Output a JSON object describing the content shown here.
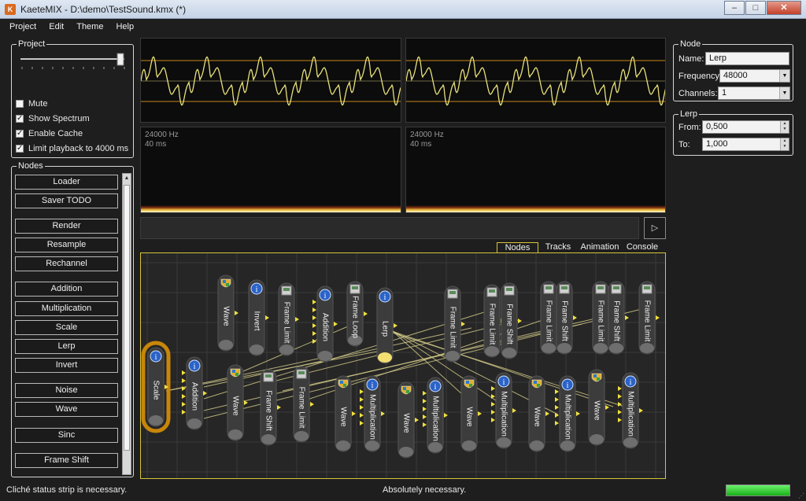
{
  "window": {
    "title": "KaeteMIX - D:\\demo\\TestSound.kmx (*)",
    "app_icon_text": "K",
    "controls": [
      "–",
      "□",
      "✕"
    ]
  },
  "menubar": [
    "Project",
    "Edit",
    "Theme",
    "Help"
  ],
  "project": {
    "label": "Project",
    "volume": 0.95,
    "checkboxes": [
      {
        "label": "Mute",
        "checked": false
      },
      {
        "label": "Show Spectrum",
        "checked": true
      },
      {
        "label": "Enable Cache",
        "checked": true
      },
      {
        "label": "Limit playback to 4000 ms",
        "checked": true
      }
    ]
  },
  "nodes_panel": {
    "label": "Nodes",
    "buttons": [
      "Loader",
      "Saver TODO",
      "Render",
      "Resample",
      "Rechannel",
      "Addition",
      "Multiplication",
      "Scale",
      "Lerp",
      "Invert",
      "Noise",
      "Wave",
      "Sinc",
      "Frame Shift"
    ]
  },
  "spectrum": {
    "left": {
      "freq": "24000 Hz",
      "time": "40 ms"
    },
    "right": {
      "freq": "24000 Hz",
      "time": "40 ms"
    }
  },
  "play_icon": "play-icon",
  "tabs": [
    {
      "label": "Nodes",
      "active": true
    },
    {
      "label": "Tracks",
      "active": false
    },
    {
      "label": "Animation",
      "active": false
    },
    {
      "label": "Console",
      "active": false
    }
  ],
  "graph_nodes": [
    "Scale",
    "Addition",
    "Wave",
    "Invert",
    "Frame Limit",
    "Addition",
    "Frame Loop",
    "Lerp",
    "Frame Limit",
    "Frame Limit",
    "Frame Shift",
    "Frame Limit",
    "Frame Shift",
    "Frame Limit",
    "Frame Shift",
    "Frame Limit",
    "Wave",
    "Frame Shift",
    "Frame Limit",
    "Wave",
    "Multiplication",
    "Wave",
    "Multiplication",
    "Wave",
    "Multiplication",
    "Wave",
    "Multiplication",
    "Wave",
    "Multiplication"
  ],
  "node_props": {
    "label": "Node",
    "name_label": "Name:",
    "name_value": "Lerp",
    "frequency_label": "Frequency:",
    "frequency_value": "48000",
    "channels_label": "Channels:",
    "channels_value": "1"
  },
  "lerp_props": {
    "label": "Lerp",
    "from_label": "From:",
    "from_value": "0,500",
    "to_label": "To:",
    "to_value": "1,000"
  },
  "status": {
    "left": "Cliché status strip is necessary.",
    "center": "Absolutely necessary.",
    "progress": 1.0
  },
  "colors": {
    "accent": "#e8d23a",
    "selected_node": "#c8860a",
    "background": "#1e1e1e",
    "progress": "#22c422"
  }
}
